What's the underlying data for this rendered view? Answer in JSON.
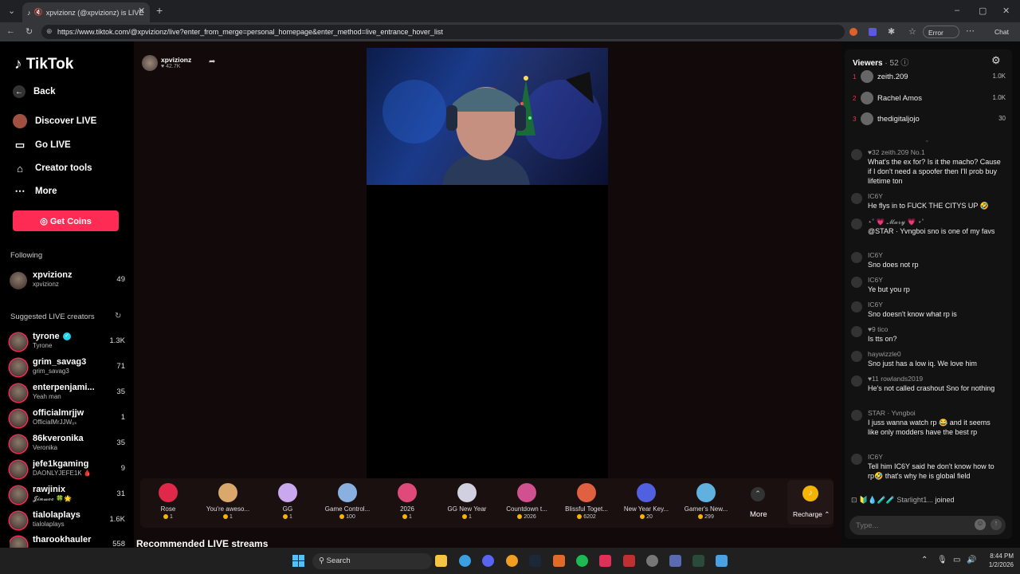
{
  "browser": {
    "tab_title": "xpvizionz (@xpvizionz) is LIVE",
    "url": "https://www.tiktok.com/@xpvizionz/live?enter_from_merge=personal_homepage&enter_method=live_entrance_hover_list",
    "error_label": "Error",
    "chat_label": "Chat"
  },
  "sidebar": {
    "logo": "TikTok",
    "back": "Back",
    "nav": [
      "Discover LIVE",
      "Go LIVE",
      "Creator tools",
      "More"
    ],
    "get_coins": "Get Coins",
    "following_heading": "Following",
    "following": [
      {
        "name": "xpvizionz",
        "sub": "xpvizionz",
        "count": "49"
      }
    ],
    "suggested_heading": "Suggested LIVE creators",
    "suggested": [
      {
        "name": "tyrone",
        "sub": "Tyrone",
        "count": "1.3K",
        "verified": true
      },
      {
        "name": "grim_savag3",
        "sub": "grim_savag3",
        "count": "71"
      },
      {
        "name": "enterpenjami...",
        "sub": "Yeah man",
        "count": "35"
      },
      {
        "name": "officialmrjjw",
        "sub": "OfficialMrJJWᵤₛ",
        "count": "1"
      },
      {
        "name": "86kveronika",
        "sub": "Veronika",
        "count": "35"
      },
      {
        "name": "jefe1kgaming",
        "sub": "DAONLYJEFE1K 🩸",
        "count": "9"
      },
      {
        "name": "rawjinix",
        "sub": "𝓙𝓲𝓷𝔀𝓸𝓸 🍀🌟",
        "count": "31"
      },
      {
        "name": "tialolaplays",
        "sub": "tialolaplays",
        "count": "1.6K"
      },
      {
        "name": "tharookhauler",
        "sub": "",
        "count": "558"
      }
    ]
  },
  "stream": {
    "host": "xpvizionz",
    "likes": "♥ 42.7K"
  },
  "gifts": [
    {
      "name": "Rose",
      "price": "1",
      "color": "#e0284a"
    },
    {
      "name": "You're aweso...",
      "price": "1",
      "color": "#d9a86a"
    },
    {
      "name": "GG",
      "price": "1",
      "color": "#c9a8f0"
    },
    {
      "name": "Game Control...",
      "price": "100",
      "color": "#8ab0e0"
    },
    {
      "name": "2026",
      "price": "1",
      "color": "#e04a7a"
    },
    {
      "name": "GG New Year",
      "price": "1",
      "color": "#d0d0e0"
    },
    {
      "name": "Countdown t...",
      "price": "2026",
      "color": "#d05090"
    },
    {
      "name": "Blissful Toget...",
      "price": "6202",
      "color": "#e06040"
    },
    {
      "name": "New Year Key...",
      "price": "20",
      "color": "#5060e0"
    },
    {
      "name": "Gamer's New...",
      "price": "299",
      "color": "#60b0e0"
    }
  ],
  "gift_more": "More",
  "recharge": "Recharge ⌃",
  "recommended": "Recommended LIVE streams",
  "chat": {
    "viewers_label": "Viewers",
    "viewers_count": "· 52",
    "top_viewers": [
      {
        "rank": "1",
        "name": "zeith.209",
        "score": "1.0K"
      },
      {
        "rank": "2",
        "name": "Rachel Amos",
        "score": "1.0K"
      },
      {
        "rank": "3",
        "name": "thedigitaljojo",
        "score": "30"
      }
    ],
    "messages": [
      {
        "user": "♥32  zeith.209  No.1",
        "text": "What's the ex for? Is it the macho? Cause if I don't need a spoofer then I'll prob buy lifetime ton"
      },
      {
        "user": "IC6Y",
        "text": "He flys in to FUCK THE CITYS UP 🤣"
      },
      {
        "user": "⋆˚ 💗 𝓜𝓪𝓻𝔂 💗 ⋆˚",
        "text": "@STAR · Yvngboi sno is one of my favs"
      },
      {
        "user": "IC6Y",
        "text": "Sno does not rp"
      },
      {
        "user": "IC6Y",
        "text": "Ye but you rp"
      },
      {
        "user": "IC6Y",
        "text": "Sno doesn't know what rp is"
      },
      {
        "user": "♥9  tico",
        "text": "Is tts on?"
      },
      {
        "user": "haywizzle0",
        "text": "Sno just has a low iq. We love him"
      },
      {
        "user": "♥11  rowlands2019",
        "text": "He's not called crashout Sno for nothing"
      },
      {
        "user": "STAR · Yvngboi",
        "text": "I juss wanna watch rp 😂 and it seems like only modders have the best rp"
      },
      {
        "user": "IC6Y",
        "text": "Tell him IC6Y said he don't know how to rp🤣 that's why he is global field"
      }
    ],
    "join_user": "Starlight1...",
    "join_text": "joined",
    "input_placeholder": "Type..."
  },
  "taskbar": {
    "search": "Search",
    "time": "8:44 PM",
    "date": "1/2/2026"
  }
}
